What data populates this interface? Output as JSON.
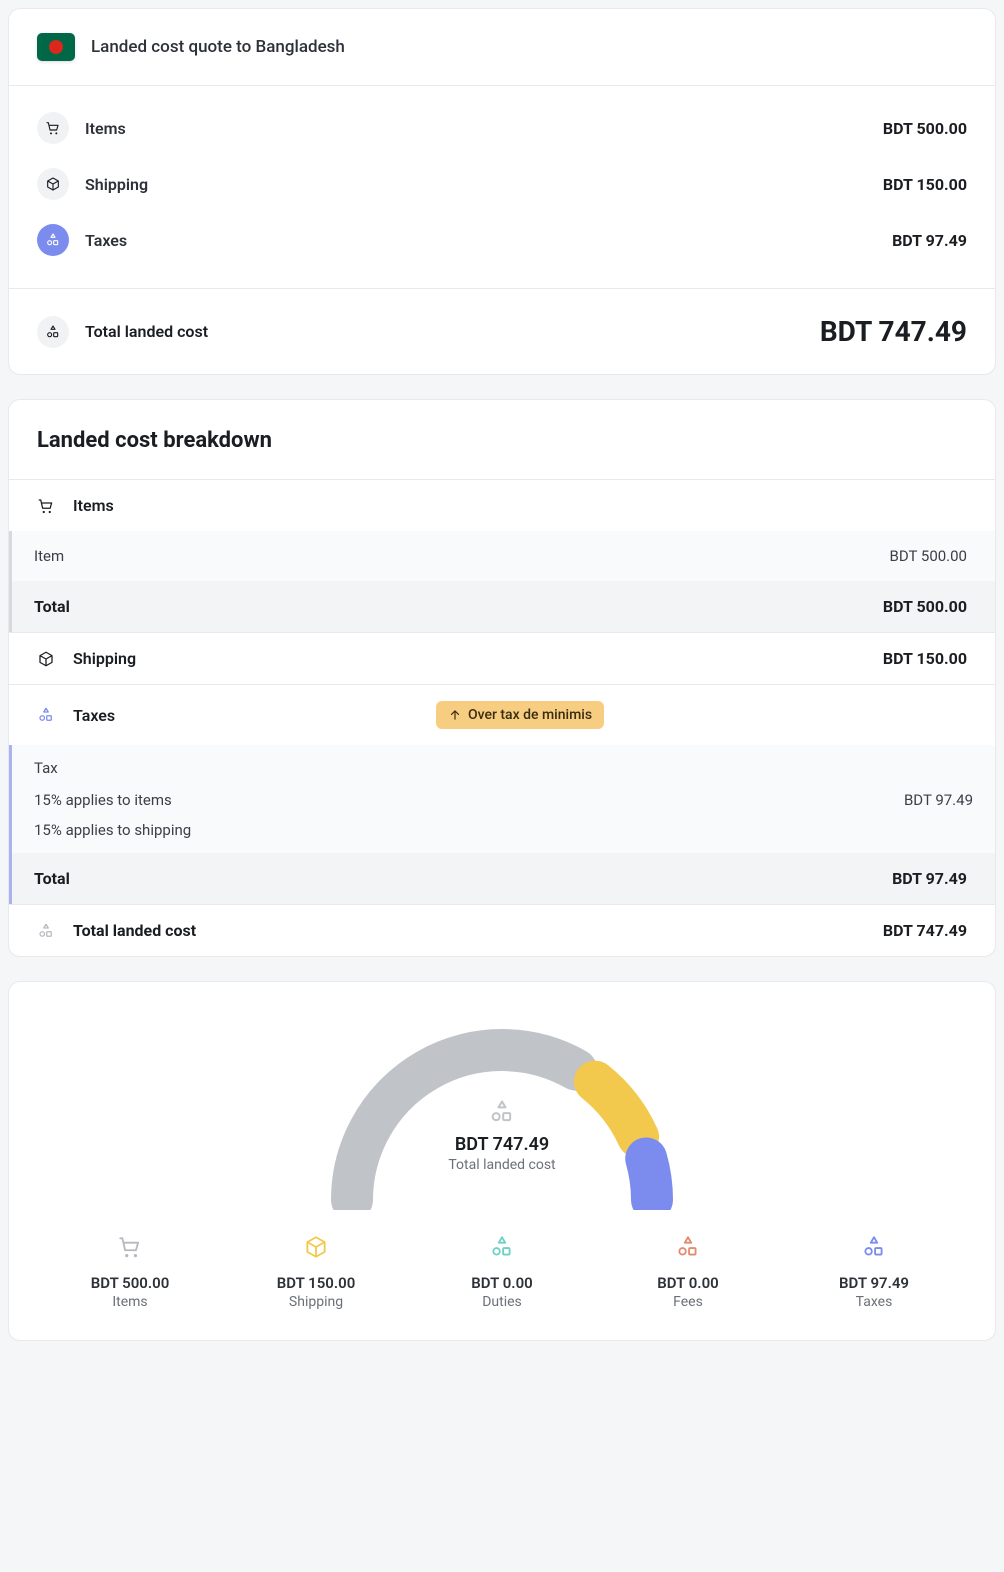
{
  "quote": {
    "title": "Landed cost quote to Bangladesh",
    "rows": {
      "items": {
        "label": "Items",
        "value": "BDT 500.00"
      },
      "shipping": {
        "label": "Shipping",
        "value": "BDT 150.00"
      },
      "taxes": {
        "label": "Taxes",
        "value": "BDT 97.49"
      }
    },
    "total": {
      "label": "Total landed cost",
      "value": "BDT 747.49"
    }
  },
  "breakdown": {
    "title": "Landed cost breakdown",
    "items": {
      "header": "Items",
      "row": {
        "label": "Item",
        "value": "BDT 500.00"
      },
      "total": {
        "label": "Total",
        "value": "BDT 500.00"
      }
    },
    "shipping": {
      "label": "Shipping",
      "value": "BDT 150.00"
    },
    "taxes": {
      "header": "Taxes",
      "badge": "Over tax de minimis",
      "block_header": "Tax",
      "lines": [
        {
          "label": "15% applies to items",
          "value": "BDT 97.49"
        },
        {
          "label": "15% applies to shipping",
          "value": ""
        }
      ],
      "total": {
        "label": "Total",
        "value": "BDT 97.49"
      }
    },
    "grand": {
      "label": "Total landed cost",
      "value": "BDT 747.49"
    }
  },
  "gauge": {
    "center_amount": "BDT 747.49",
    "center_label": "Total landed cost",
    "categories": [
      {
        "amount": "BDT 500.00",
        "label": "Items"
      },
      {
        "amount": "BDT 150.00",
        "label": "Shipping"
      },
      {
        "amount": "BDT 0.00",
        "label": "Duties"
      },
      {
        "amount": "BDT 0.00",
        "label": "Fees"
      },
      {
        "amount": "BDT 97.49",
        "label": "Taxes"
      }
    ]
  },
  "chart_data": {
    "type": "pie",
    "title": "Total landed cost",
    "series": [
      {
        "name": "Items",
        "value": 500.0,
        "color": "#c0c3c8"
      },
      {
        "name": "Shipping",
        "value": 150.0,
        "color": "#f2c94c"
      },
      {
        "name": "Duties",
        "value": 0.0,
        "color": "#6fd1c6"
      },
      {
        "name": "Fees",
        "value": 0.0,
        "color": "#e28b6f"
      },
      {
        "name": "Taxes",
        "value": 97.49,
        "color": "#7b8cee"
      }
    ],
    "total": 747.49,
    "currency": "BDT"
  }
}
